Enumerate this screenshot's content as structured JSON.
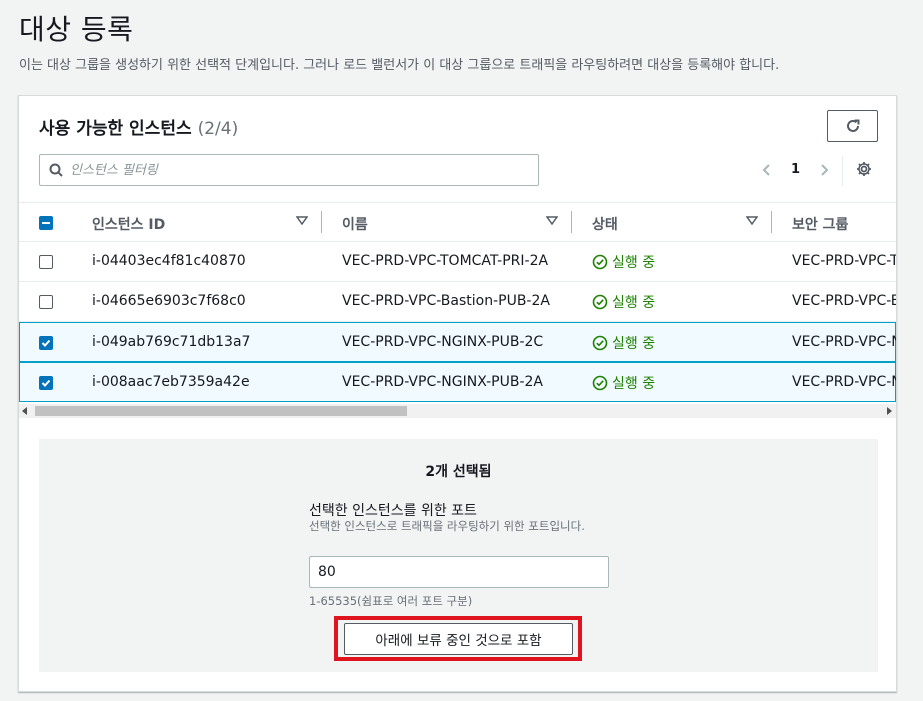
{
  "page": {
    "title": "대상 등록",
    "description": "이는 대상 그룹을 생성하기 위한 선택적 단계입니다. 그러나 로드 밸런서가 이 대상 그룹으로 트래픽을 라우팅하려면 대상을 등록해야 합니다."
  },
  "instances_panel": {
    "title": "사용 가능한 인스턴스",
    "count": "(2/4)",
    "refresh_icon": "refresh-icon",
    "filter_placeholder": "인스턴스 필터링",
    "current_page": "1",
    "columns": [
      "인스턴스 ID",
      "이름",
      "상태",
      "보안 그룹"
    ],
    "rows": [
      {
        "id": "i-04403ec4f81c40870",
        "name": "VEC-PRD-VPC-TOMCAT-PRI-2A",
        "state": "실행 중",
        "security_group": "VEC-PRD-VPC-TOMCAT",
        "selected": false
      },
      {
        "id": "i-04665e6903c7f68c0",
        "name": "VEC-PRD-VPC-Bastion-PUB-2A",
        "state": "실행 중",
        "security_group": "VEC-PRD-VPC-Bastion",
        "selected": false
      },
      {
        "id": "i-049ab769c71db13a7",
        "name": "VEC-PRD-VPC-NGINX-PUB-2C",
        "state": "실행 중",
        "security_group": "VEC-PRD-VPC-NGINX",
        "selected": true
      },
      {
        "id": "i-008aac7eb7359a42e",
        "name": "VEC-PRD-VPC-NGINX-PUB-2A",
        "state": "실행 중",
        "security_group": "VEC-PRD-VPC-NGINX",
        "selected": true
      }
    ]
  },
  "selection_box": {
    "selected_count": "2개 선택됨",
    "port_label": "선택한 인스턴스를 위한 포트",
    "port_description": "선택한 인스턴스로 트래픽을 라우팅하기 위한 포트입니다.",
    "port_value": "80",
    "port_range": "1-65535(쉼표로 여러 포트 구분)",
    "include_button": "아래에 보류 중인 것으로 포함"
  },
  "colors": {
    "accent": "#0073bb",
    "running": "#1d8102",
    "highlight": "#e0141e"
  }
}
